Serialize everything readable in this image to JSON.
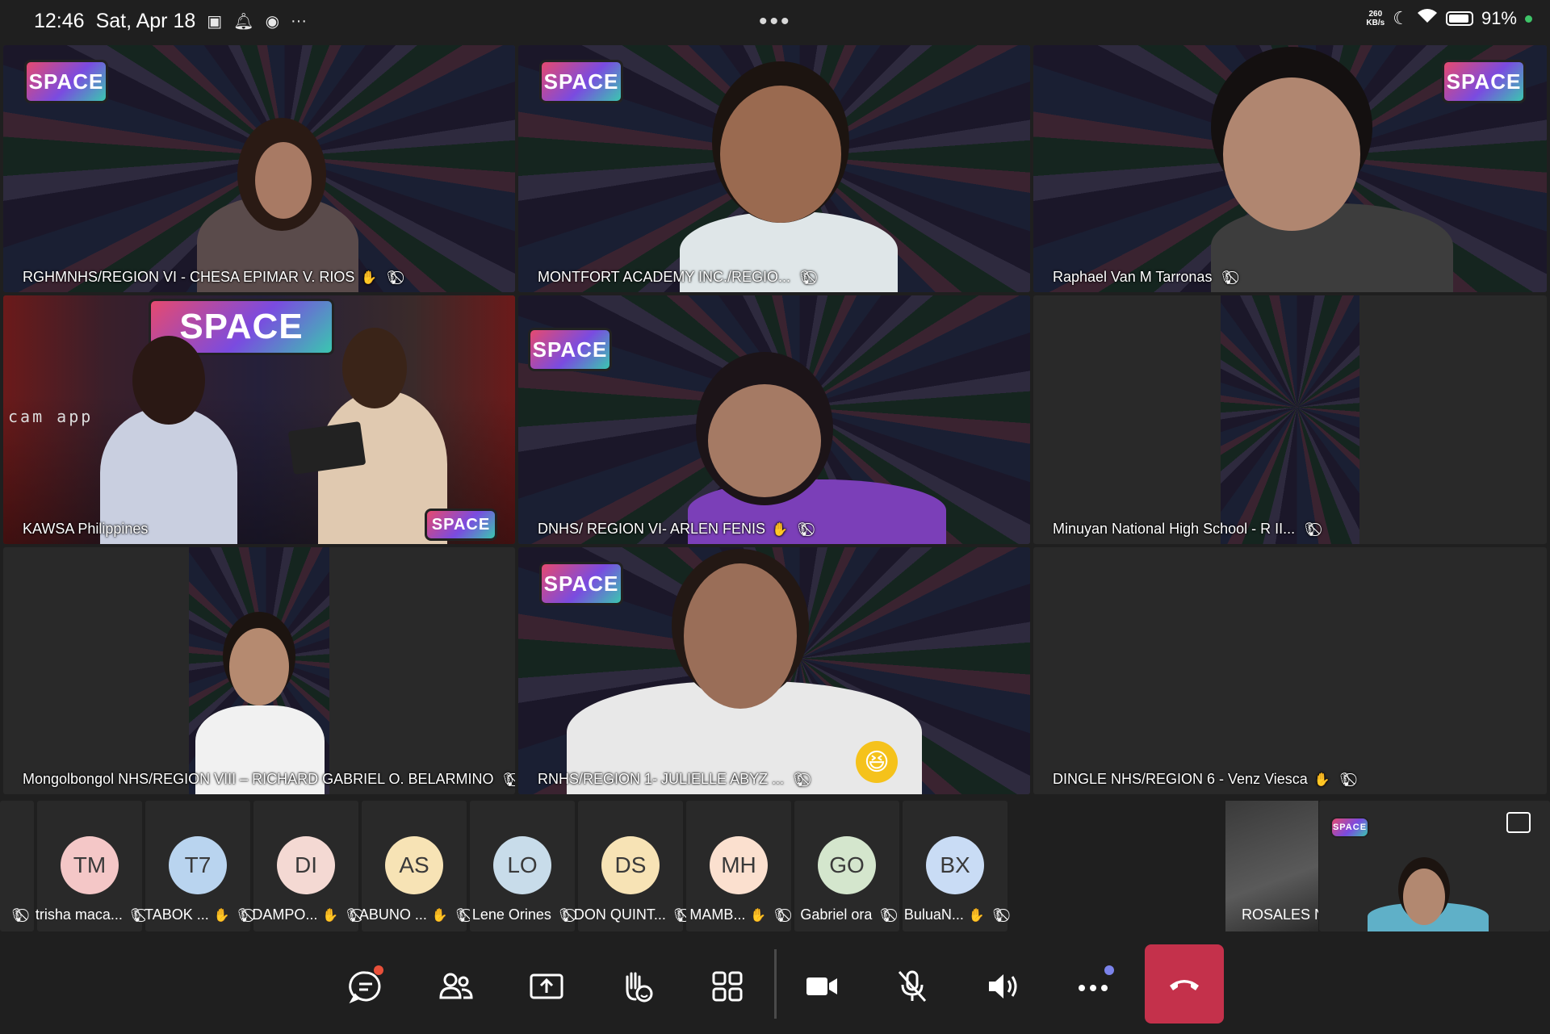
{
  "status_bar": {
    "time": "12:46",
    "date": "Sat, Apr 18",
    "more_dots": "•••",
    "net_speed_value": "260",
    "net_speed_unit": "KB/s",
    "battery": "91%"
  },
  "tiles": [
    {
      "name": "RGHMNHS/REGION VI - CHESA EPIMAR V. RIOS",
      "raised_hand": true
    },
    {
      "name": "MONTFORT ACADEMY INC./REGIO...",
      "raised_hand": false
    },
    {
      "name": "Raphael Van M Tarronas",
      "raised_hand": false
    },
    {
      "name": "KAWSA Philippines",
      "raised_hand": false
    },
    {
      "name": "DNHS/ REGION VI- ARLEN FENIS",
      "raised_hand": true
    },
    {
      "name": "Minuyan National High School - R II...",
      "raised_hand": false
    },
    {
      "name": "Mongolbongol NHS/REGION VIII – RICHARD GABRIEL O. BELARMINO",
      "raised_hand": false
    },
    {
      "name": "RNHS/REGION 1- JULIELLE ABYZ ...",
      "raised_hand": false
    },
    {
      "name": "DINGLE NHS/REGION 6 - Venz Viesca",
      "raised_hand": true
    }
  ],
  "logo_text": "SPACE",
  "studio_text": "cam app",
  "reaction_emoji": "😆",
  "participants": [
    {
      "initials": "TM",
      "name": "trisha maca...",
      "color": "#f4c7c7",
      "raised_hand": false
    },
    {
      "initials": "T7",
      "name": "TABOK ...",
      "color": "#b9d4ef",
      "raised_hand": true
    },
    {
      "initials": "DI",
      "name": "DAMPO...",
      "color": "#f4d9d3",
      "raised_hand": true
    },
    {
      "initials": "AS",
      "name": "ABUNO ...",
      "color": "#f7e3b5",
      "raised_hand": true
    },
    {
      "initials": "LO",
      "name": "Lene Orines",
      "color": "#c8dcea",
      "raised_hand": false
    },
    {
      "initials": "DS",
      "name": "DON QUINT...",
      "color": "#f7e3b5",
      "raised_hand": false
    },
    {
      "initials": "MH",
      "name": "MAMB...",
      "color": "#fbe0cf",
      "raised_hand": true
    },
    {
      "initials": "GO",
      "name": "Gabriel ora",
      "color": "#d4e6cd",
      "raised_hand": false
    },
    {
      "initials": "BX",
      "name": "BuluaN...",
      "color": "#c9dcf5",
      "raised_hand": true
    }
  ],
  "rosales_name": "ROSALES N",
  "colors": {
    "end_call": "#c4314b",
    "notification_dot": "#e8503a",
    "more_dot": "#7b83eb"
  }
}
